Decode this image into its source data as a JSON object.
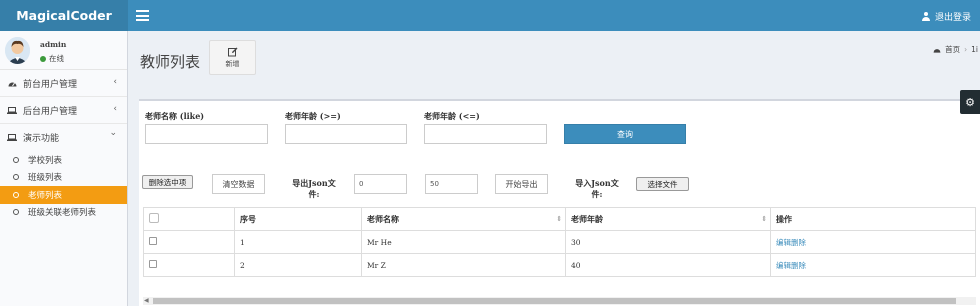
{
  "app": {
    "logo": "MagicalCoder",
    "logout_label": "退出登录"
  },
  "user": {
    "name": "admin",
    "status": "在线"
  },
  "sidebar": {
    "items": [
      {
        "label": "前台用户管理",
        "caret": "‹"
      },
      {
        "label": "后台用户管理",
        "caret": "‹"
      },
      {
        "label": "演示功能",
        "caret": "⌄"
      }
    ],
    "subitems": [
      {
        "label": "学校列表"
      },
      {
        "label": "班级列表"
      },
      {
        "label": "老师列表",
        "active": true
      },
      {
        "label": "班级关联老师列表"
      }
    ]
  },
  "page": {
    "title": "教师列表",
    "add_label": "新增",
    "breadcrumb_home": "首页",
    "breadcrumb_next": "1i"
  },
  "filters": {
    "name_label": "老师名称 (like)",
    "age_gte_label": "老师年龄 (>=)",
    "age_lte_label": "老师年龄 (<=)",
    "query_label": "查询"
  },
  "actions": {
    "delete_selected": "删除选中项",
    "clear_data": "清空数据",
    "export_label": "导出Json文件:",
    "export_start": "0",
    "export_count": "50",
    "start_export": "开始导出",
    "import_label": "导入Json文件:",
    "choose_file": "选择文件"
  },
  "table": {
    "headers": [
      "",
      "序号",
      "老师名称",
      "老师年龄",
      "操作"
    ],
    "rows": [
      {
        "id": "1",
        "name": "Mr He",
        "age": "30",
        "edit": "编辑",
        "delete": "删除"
      },
      {
        "id": "2",
        "name": "Mr Z",
        "age": "40",
        "edit": "编辑",
        "delete": "删除"
      }
    ]
  },
  "colors": {
    "brand": "#3c8dbc",
    "logo_bg": "#367fa9",
    "active": "#f39c12"
  }
}
